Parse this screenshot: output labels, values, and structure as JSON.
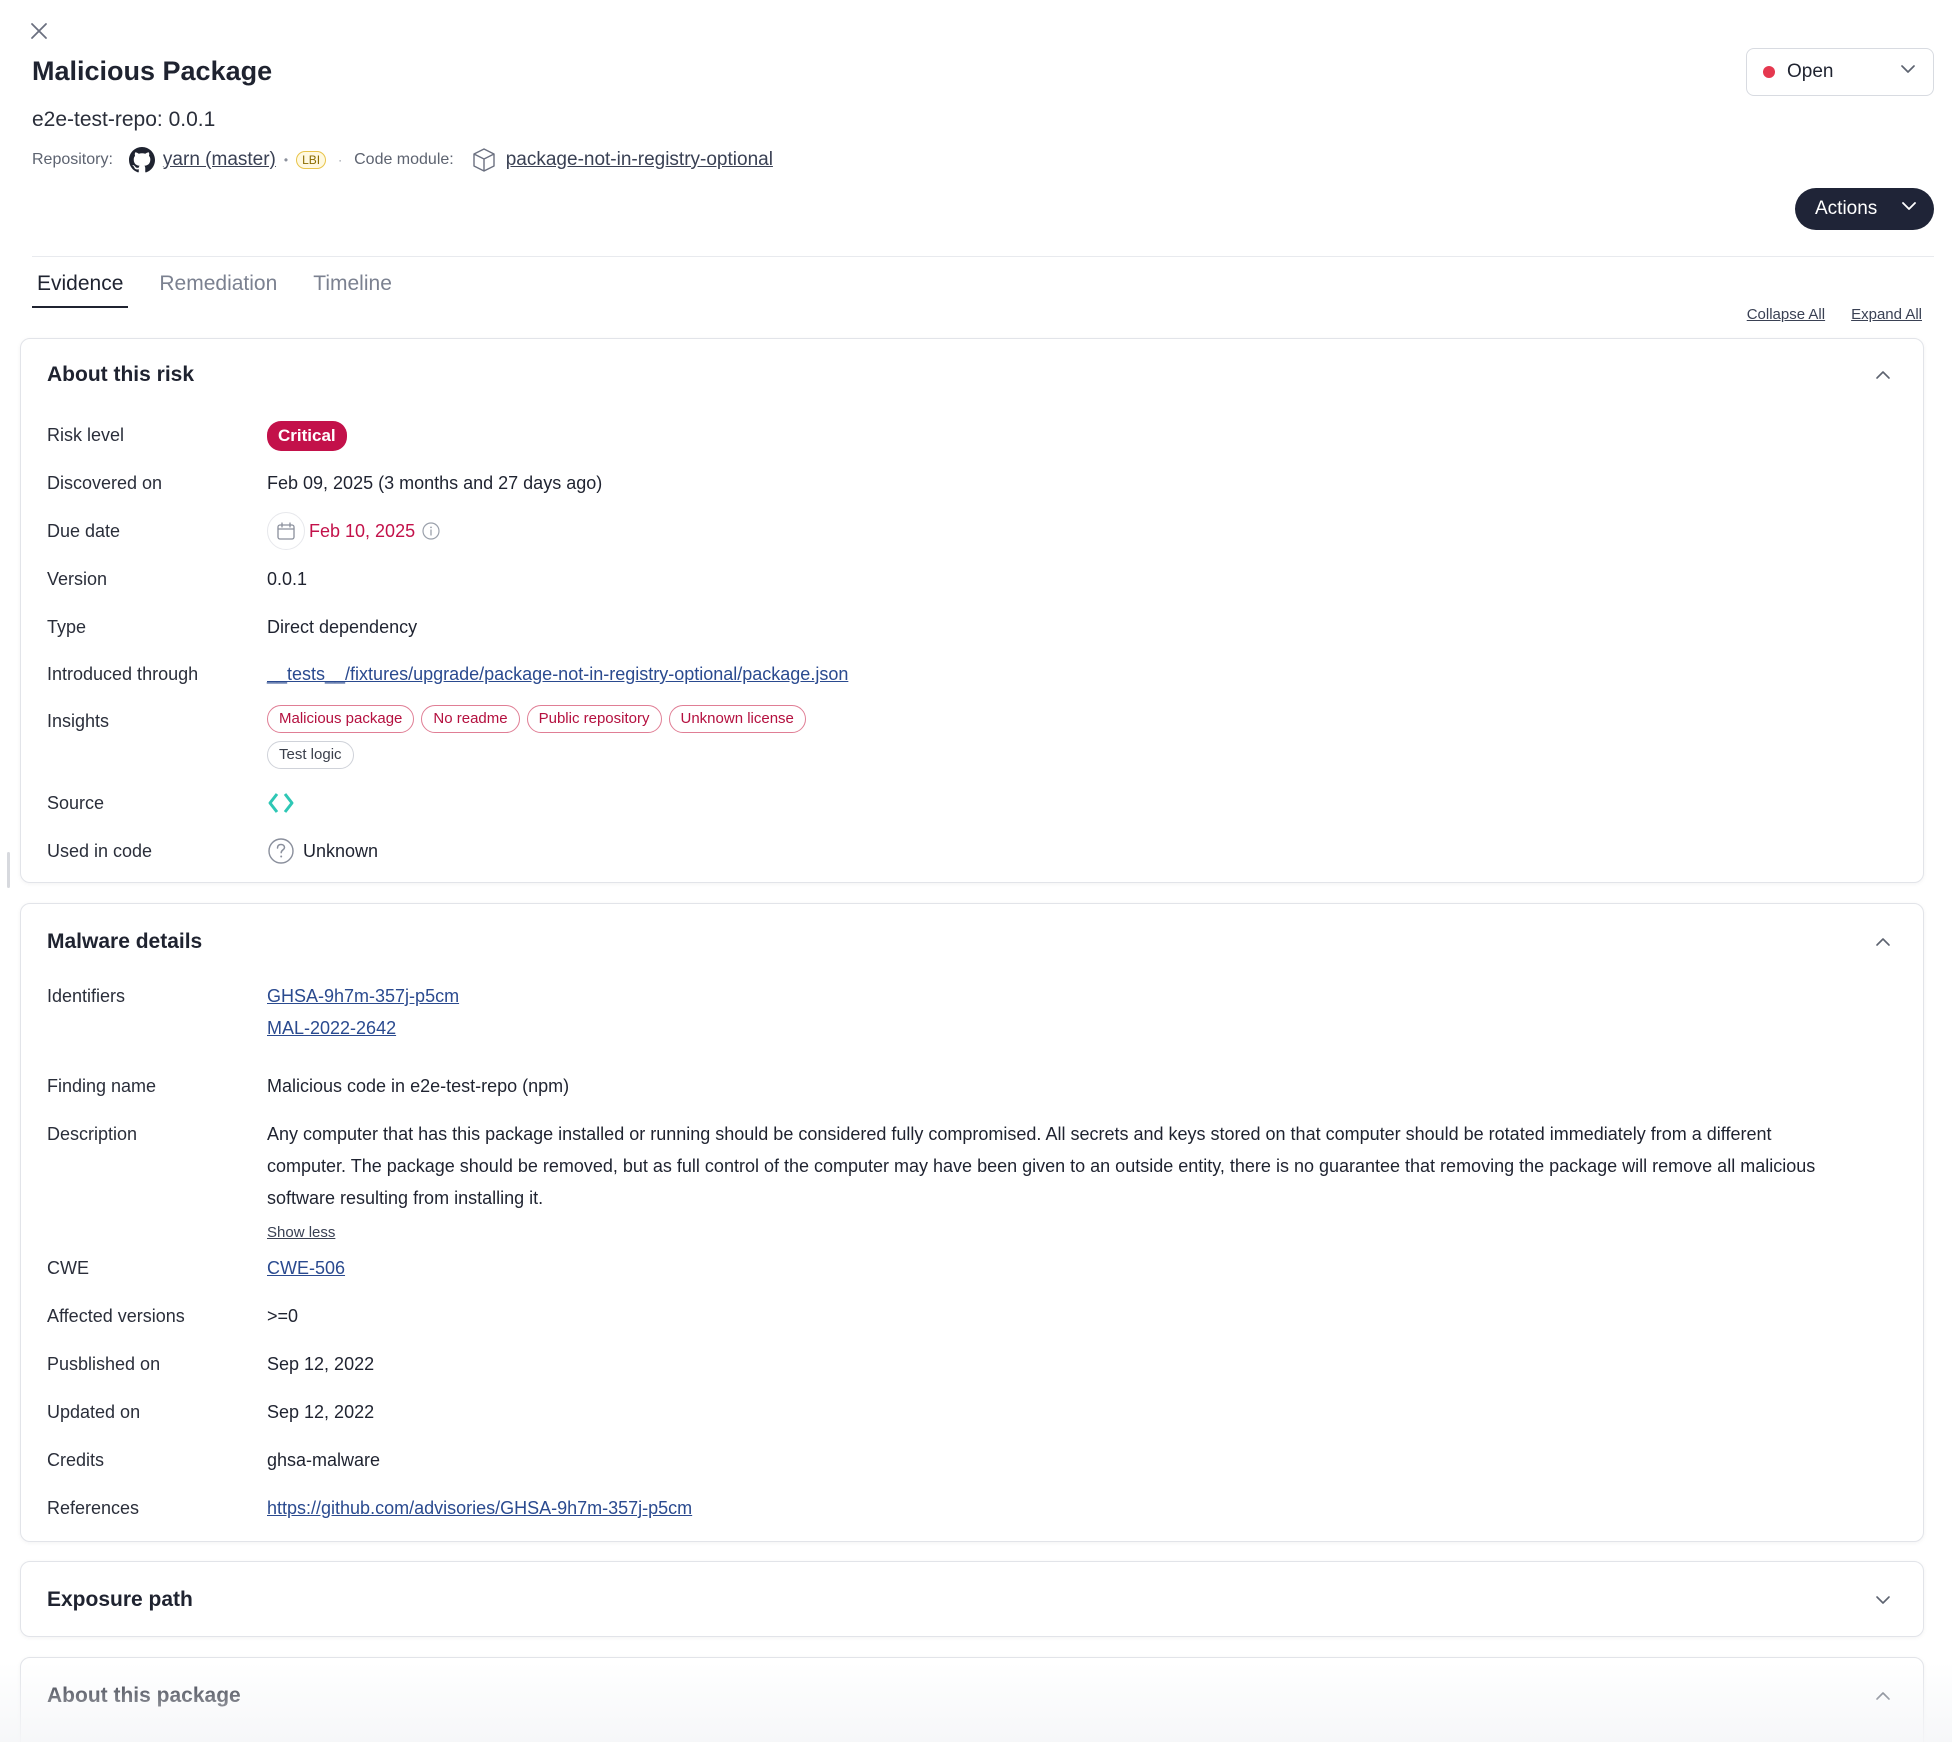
{
  "header": {
    "title": "Malicious Package",
    "subtitle": "e2e-test-repo: 0.0.1",
    "repository_label": "Repository:",
    "repository_name": "yarn (master)",
    "lbi_badge": "LBI",
    "code_module_label": "Code module:",
    "code_module_name": "package-not-in-registry-optional"
  },
  "status": {
    "value": "Open",
    "dot_color": "#e5384f"
  },
  "actions_label": "Actions",
  "tabs": [
    {
      "label": "Evidence",
      "active": true
    },
    {
      "label": "Remediation",
      "active": false
    },
    {
      "label": "Timeline",
      "active": false
    }
  ],
  "collapse_all": "Collapse All",
  "expand_all": "Expand All",
  "about_risk": {
    "title": "About this risk",
    "risk_level_label": "Risk level",
    "risk_level": "Critical",
    "discovered_label": "Discovered on",
    "discovered": "Feb 09, 2025 (3 months and 27 days ago)",
    "due_label": "Due date",
    "due": "Feb 10, 2025",
    "version_label": "Version",
    "version": "0.0.1",
    "type_label": "Type",
    "type": "Direct dependency",
    "introduced_label": "Introduced through",
    "introduced": "__tests__/fixtures/upgrade/package-not-in-registry-optional/package.json",
    "insights_label": "Insights",
    "insights": [
      "Malicious package",
      "No readme",
      "Public repository",
      "Unknown license"
    ],
    "insights_neutral": [
      "Test logic"
    ],
    "source_label": "Source",
    "used_label": "Used in code",
    "used": "Unknown"
  },
  "malware": {
    "title": "Malware details",
    "identifiers_label": "Identifiers",
    "identifiers": [
      "GHSA-9h7m-357j-p5cm",
      "MAL-2022-2642"
    ],
    "finding_label": "Finding name",
    "finding": "Malicious code in e2e-test-repo (npm)",
    "description_label": "Description",
    "description": "Any computer that has this package installed or running should be considered fully compromised. All secrets and keys stored on that computer should be rotated immediately from a different computer. The package should be removed, but as full control of the computer may have been given to an outside entity, there is no guarantee that removing the package will remove all malicious software resulting from installing it.",
    "show_less": "Show less",
    "cwe_label": "CWE",
    "cwe": "CWE-506",
    "affected_label": "Affected versions",
    "affected": ">=0",
    "published_label": "Pusblished on",
    "published": "Sep 12, 2022",
    "updated_label": "Updated on",
    "updated": "Sep 12, 2022",
    "credits_label": "Credits",
    "credits": "ghsa-malware",
    "references_label": "References",
    "references": "https://github.com/advisories/GHSA-9h7m-357j-p5cm"
  },
  "exposure": {
    "title": "Exposure path"
  },
  "about_package": {
    "title": "About this package"
  },
  "colors": {
    "critical": "#c3114a",
    "primary_dark": "#1f2437",
    "link": "#2a4a8f"
  },
  "icons": [
    "close-icon",
    "chevron-down-icon",
    "chevron-up-icon",
    "github-icon",
    "package-icon",
    "calendar-icon",
    "info-icon",
    "source-icon",
    "question-circle-icon"
  ]
}
